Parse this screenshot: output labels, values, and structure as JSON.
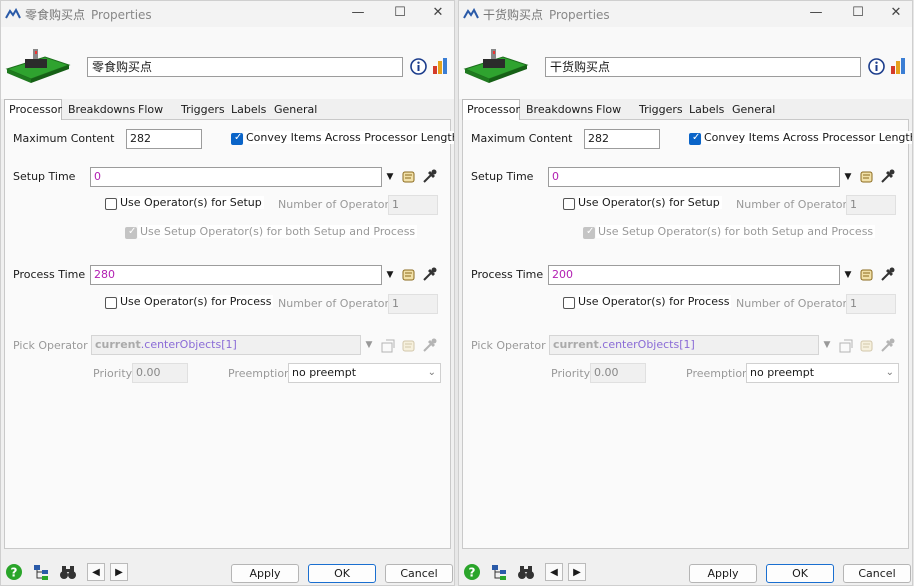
{
  "windows": [
    {
      "title": "零食购买点",
      "title_suffix": "Properties",
      "name_value": "零食购买点",
      "tabs": [
        "Processor",
        "Breakdowns",
        "Flow",
        "Triggers",
        "Labels",
        "General"
      ],
      "max_content_label": "Maximum Content",
      "max_content_value": "282",
      "convey_label": "Convey Items Across Processor Length",
      "convey_checked": true,
      "setup_time_label": "Setup Time",
      "setup_time_value": "0",
      "use_op_setup_label": "Use Operator(s) for Setup",
      "num_ops_label": "Number of Operators",
      "num_ops_setup_value": "1",
      "use_setup_both_label": "Use Setup Operator(s) for both Setup and Process",
      "process_time_label": "Process Time",
      "process_time_value": "280",
      "use_op_process_label": "Use Operator(s) for Process",
      "num_ops_process_value": "1",
      "pick_operator_label": "Pick Operator",
      "pick_kw": "current",
      "pick_dot": ".",
      "pick_prop": "centerObjects",
      "pick_idx": "[1]",
      "priority_label": "Priority",
      "priority_value": "0.00",
      "preemption_label": "Preemption",
      "preemption_value": "no preempt"
    },
    {
      "title": "干货购买点",
      "title_suffix": "Properties",
      "name_value": "干货购买点",
      "tabs": [
        "Processor",
        "Breakdowns",
        "Flow",
        "Triggers",
        "Labels",
        "General"
      ],
      "max_content_label": "Maximum Content",
      "max_content_value": "282",
      "convey_label": "Convey Items Across Processor Length",
      "convey_checked": true,
      "setup_time_label": "Setup Time",
      "setup_time_value": "0",
      "use_op_setup_label": "Use Operator(s) for Setup",
      "num_ops_label": "Number of Operators",
      "num_ops_setup_value": "1",
      "use_setup_both_label": "Use Setup Operator(s) for both Setup and Process",
      "process_time_label": "Process Time",
      "process_time_value": "200",
      "use_op_process_label": "Use Operator(s) for Process",
      "num_ops_process_value": "1",
      "pick_operator_label": "Pick Operator",
      "pick_kw": "current",
      "pick_dot": ".",
      "pick_prop": "centerObjects",
      "pick_idx": "[1]",
      "priority_label": "Priority",
      "priority_value": "0.00",
      "preemption_label": "Preemption",
      "preemption_value": "no preempt"
    }
  ],
  "footer": {
    "apply_label": "Apply",
    "ok_label": "OK",
    "cancel_label": "Cancel"
  },
  "colors": {
    "code_value": "#b21fb2",
    "accent": "#0a64c8",
    "model_green": "#2fa32f"
  },
  "icons": [
    "app-logo-icon",
    "minimize-icon",
    "maximize-icon",
    "close-icon",
    "model-preview-icon",
    "info-icon",
    "statistics-icon",
    "dropdown-arrow-icon",
    "code-edit-icon",
    "sampler-icon",
    "help-icon",
    "tree-icon",
    "binoculars-icon",
    "previous-icon",
    "next-icon"
  ]
}
